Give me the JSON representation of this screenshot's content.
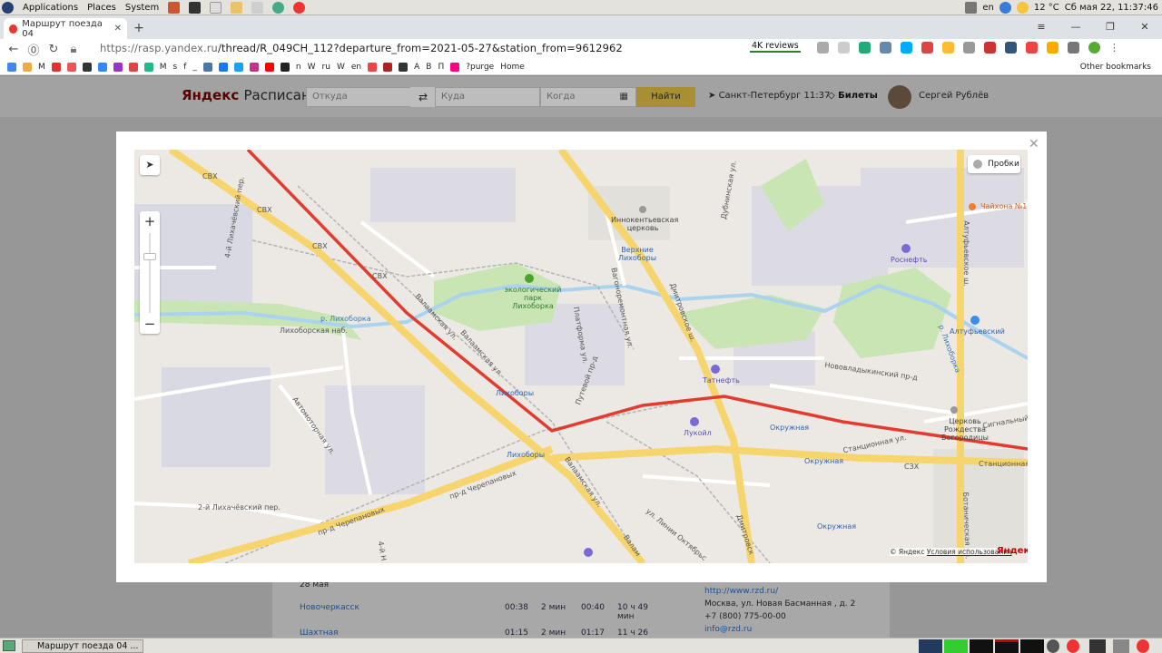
{
  "system_bar": {
    "menu": [
      "Applications",
      "Places",
      "System"
    ],
    "lang": "en",
    "weather": "12 °C",
    "clock": "Сб мая 22, 11:37:46"
  },
  "browser": {
    "tab_title": "Маршрут поезда 04",
    "url_host": "https://rasp.yandex.ru",
    "url_path": "/thread/R_049CH_112?departure_from=2021-05-27&station_from=9612962",
    "reviews_label": "4K reviews",
    "other_bookmarks": "Other bookmarks",
    "bookmarks": [
      "M",
      "s",
      "f",
      "_",
      "n",
      "W",
      "ru",
      "W",
      "en",
      "A",
      "B",
      "П",
      "?purge",
      "Home"
    ]
  },
  "site": {
    "logo_main": "Яндекс",
    "logo_sub": "Расписания",
    "from_placeholder": "Откуда",
    "to_placeholder": "Куда",
    "when_placeholder": "Когда",
    "find_label": "Найти",
    "city_time": "Санкт-Петербург  11:37",
    "tickets_label": "Билеты",
    "user_name": "Сергей Рублёв"
  },
  "background_table": {
    "date": "28 мая",
    "rows": [
      {
        "station": "Новочеркасск",
        "arr": "00:38",
        "stop": "2 мин",
        "dep": "00:40",
        "travel": "10 ч 49 мин"
      },
      {
        "station": "Шахтная",
        "arr": "01:15",
        "stop": "2 мин",
        "dep": "01:17",
        "travel": "11 ч 26 мин"
      }
    ],
    "side_info": [
      "http://www.rzd.ru/",
      "Москва, ул. Новая Басманная , д. 2",
      "+7 (800) 775-00-00",
      "info@rzd.ru"
    ]
  },
  "map": {
    "traffic_label": "Пробки",
    "copyright": "© Яндекс",
    "terms": "Условия использования",
    "logo": "Яндекс",
    "labels": {
      "svh1": "СВХ",
      "svh2": "СВХ",
      "svh3": "СВХ",
      "svh4": "СВХ",
      "church": "Иннокентьевская церковь",
      "metro_vl": "Верхние Лихоборы",
      "park": "экологический парк Лихоборка",
      "dmitrovskoe": "Дмитровское ш.",
      "altufevskoe": "Алтуфьевское ш.",
      "chaikhona": "Чайхона №1",
      "rosneft": "Роснефть",
      "likhoborka_river": "р. Лихоборка",
      "likhoborka_river2": "р. Лихоборка",
      "likhoborskaya_nab": "Лихоборская наб.",
      "valaamskaya1": "Валаамская ул.",
      "valaamskaya2": "Валаамская ул.",
      "valaamskaya3": "Валаамская ул.",
      "valaamskaya4": "Валам",
      "likhobory_stn": "Лихоборы",
      "likhobory_metro": "Лихоборы",
      "tatneft": "Татнефть",
      "lukoil": "Лукойл",
      "altufevo": "Алтуфьевский",
      "novovladykinsky": "Нововладыкинский пр-д",
      "church2": "Церковь Рождества Богородицы",
      "signalny": "Сигнальный п",
      "okruzhnaya1": "Окружная",
      "okruzhnaya2": "Окружная",
      "okruzhnaya3": "Окружная",
      "stantsionnaya": "Станционная ул.",
      "stantsionnaya2": "Станционная ул.",
      "szh": "СЗХ",
      "avtomotornaya": "Автомоторная ул.",
      "cheterpanovyh1": "пр-д Черепановых",
      "cheterpanovyh2": "пр-д Черепановых",
      "likhachevsky": "2-й Лихачёвский пер.",
      "likhachevsky4": "4-й Лихачёвский пер.",
      "botanicheskaya": "Ботаническая ул.",
      "liniya": "ул. Линии Октябрьс",
      "dmitrovskoe2": "Дмитровск",
      "nikolaya": "4-й Н",
      "plat": "Платформа ул.",
      "dubninskaya": "Дубнинская ул.",
      "vostochny": "Вагоноремонтная ул.",
      "pryamoy": "Путевой пр-д",
      "lihacheva": "4-й Лихачёвский пер.",
      "lazo": "р. Лихоборка"
    },
    "colors": {
      "route": "#e23b2f",
      "road_major": "#f6d56e",
      "road_minor": "#fff",
      "park": "#c9e5b4",
      "water": "#a9d3ee",
      "industrial": "#d9d9e3",
      "rail": "#b3b3b3"
    }
  }
}
